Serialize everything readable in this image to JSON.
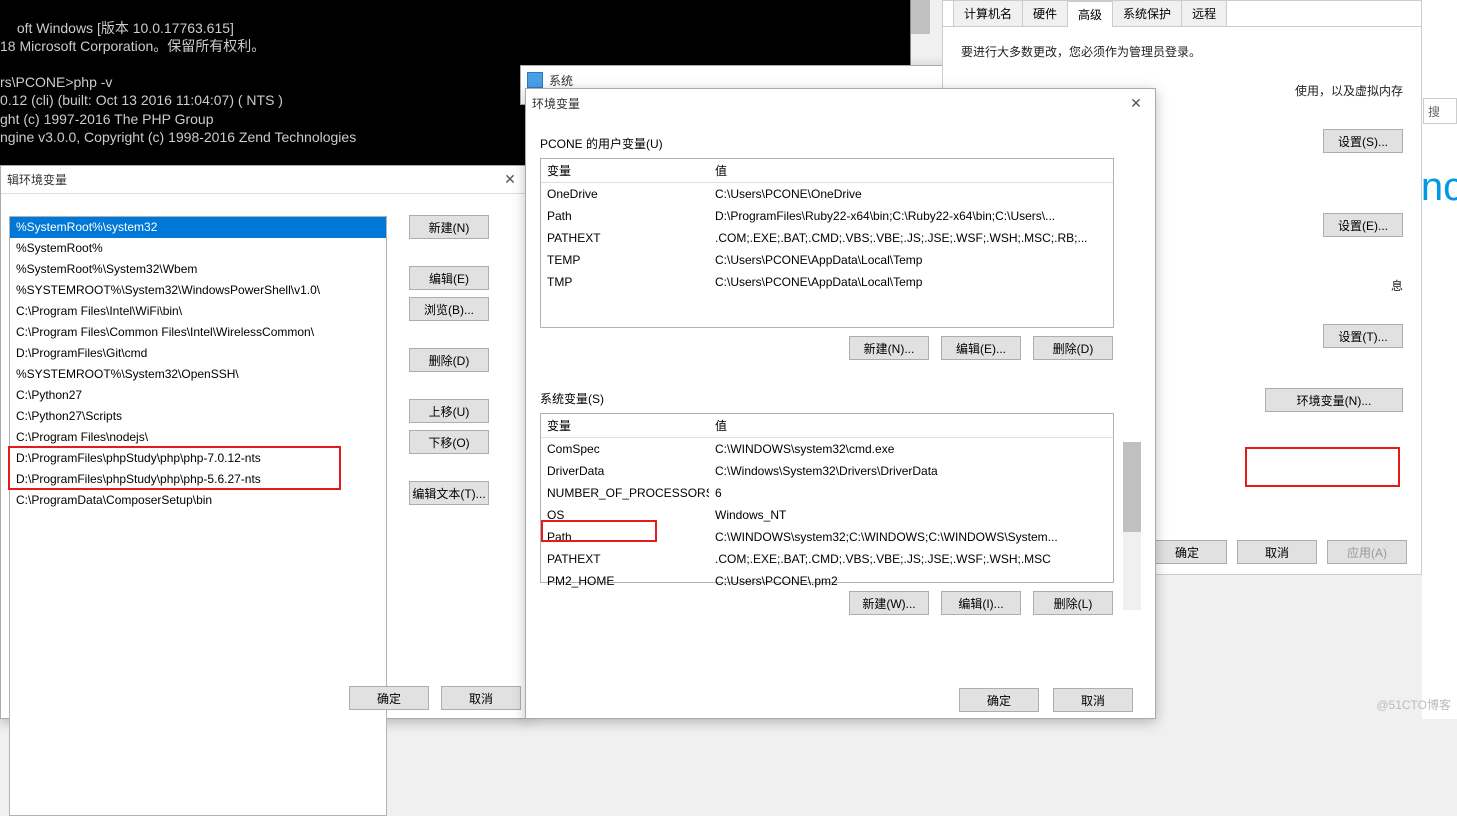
{
  "terminal": {
    "lines": "oft Windows [版本 10.0.17763.615]\n18 Microsoft Corporation。保留所有权利。\n\nrs\\PCONE>php -v\n0.12 (cli) (built: Oct 13 2016 11:04:07) ( NTS )\nght (c) 1997-2016 The PHP Group\nngine v3.0.0, Copyright (c) 1998-2016 Zend Technologies\n\nrs\\PCONE>\nrs\\PCONE>"
  },
  "editEnv": {
    "title": "辑环境变量",
    "paths": [
      "%SystemRoot%\\system32",
      "%SystemRoot%",
      "%SystemRoot%\\System32\\Wbem",
      "%SYSTEMROOT%\\System32\\WindowsPowerShell\\v1.0\\",
      "C:\\Program Files\\Intel\\WiFi\\bin\\",
      "C:\\Program Files\\Common Files\\Intel\\WirelessCommon\\",
      "D:\\ProgramFiles\\Git\\cmd",
      "%SYSTEMROOT%\\System32\\OpenSSH\\",
      "C:\\Python27",
      "C:\\Python27\\Scripts",
      "C:\\Program Files\\nodejs\\",
      "D:\\ProgramFiles\\phpStudy\\php\\php-7.0.12-nts",
      "D:\\ProgramFiles\\phpStudy\\php\\php-5.6.27-nts",
      "C:\\ProgramData\\ComposerSetup\\bin"
    ],
    "buttons": {
      "new": "新建(N)",
      "edit": "编辑(E)",
      "browse": "浏览(B)...",
      "delete": "删除(D)",
      "up": "上移(U)",
      "down": "下移(O)",
      "editText": "编辑文本(T)...",
      "ok": "确定",
      "cancel": "取消"
    }
  },
  "sysWin": {
    "title": "系统"
  },
  "envWin": {
    "title": "环境变量",
    "userSection": "PCONE 的用户变量(U)",
    "sysSection": "系统变量(S)",
    "hdrVar": "变量",
    "hdrVal": "值",
    "userVars": [
      {
        "var": "OneDrive",
        "val": "C:\\Users\\PCONE\\OneDrive"
      },
      {
        "var": "Path",
        "val": "D:\\ProgramFiles\\Ruby22-x64\\bin;C:\\Ruby22-x64\\bin;C:\\Users\\..."
      },
      {
        "var": "PATHEXT",
        "val": ".COM;.EXE;.BAT;.CMD;.VBS;.VBE;.JS;.JSE;.WSF;.WSH;.MSC;.RB;..."
      },
      {
        "var": "TEMP",
        "val": "C:\\Users\\PCONE\\AppData\\Local\\Temp"
      },
      {
        "var": "TMP",
        "val": "C:\\Users\\PCONE\\AppData\\Local\\Temp"
      }
    ],
    "sysVars": [
      {
        "var": "ComSpec",
        "val": "C:\\WINDOWS\\system32\\cmd.exe"
      },
      {
        "var": "DriverData",
        "val": "C:\\Windows\\System32\\Drivers\\DriverData"
      },
      {
        "var": "NUMBER_OF_PROCESSORS",
        "val": "6"
      },
      {
        "var": "OS",
        "val": "Windows_NT"
      },
      {
        "var": "Path",
        "val": "C:\\WINDOWS\\system32;C:\\WINDOWS;C:\\WINDOWS\\System..."
      },
      {
        "var": "PATHEXT",
        "val": ".COM;.EXE;.BAT;.CMD;.VBS;.VBE;.JS;.JSE;.WSF;.WSH;.MSC"
      },
      {
        "var": "PM2_HOME",
        "val": "C:\\Users\\PCONE\\.pm2"
      }
    ],
    "buttons": {
      "newN": "新建(N)...",
      "editE": "编辑(E)...",
      "delD": "删除(D)",
      "newW": "新建(W)...",
      "editI": "编辑(I)...",
      "delL": "删除(L)",
      "ok": "确定",
      "cancel": "取消"
    }
  },
  "props": {
    "tabs": {
      "computer": "计算机名",
      "hardware": "硬件",
      "advanced": "高级",
      "protect": "系统保护",
      "remote": "远程"
    },
    "note": "要进行大多数更改，您必须作为管理员登录。",
    "perfDesc": "使用，以及虚拟内存",
    "btnS": "设置(S)...",
    "btnE": "设置(E)...",
    "btnT": "设置(T)...",
    "restoreLabel": "息",
    "envBtn": "环境变量(N)...",
    "ok": "确定",
    "cancel": "取消",
    "apply": "应用(A)"
  },
  "right": {
    "search": "搜",
    "blue": "inc"
  },
  "watermark": "@51CTO博客"
}
